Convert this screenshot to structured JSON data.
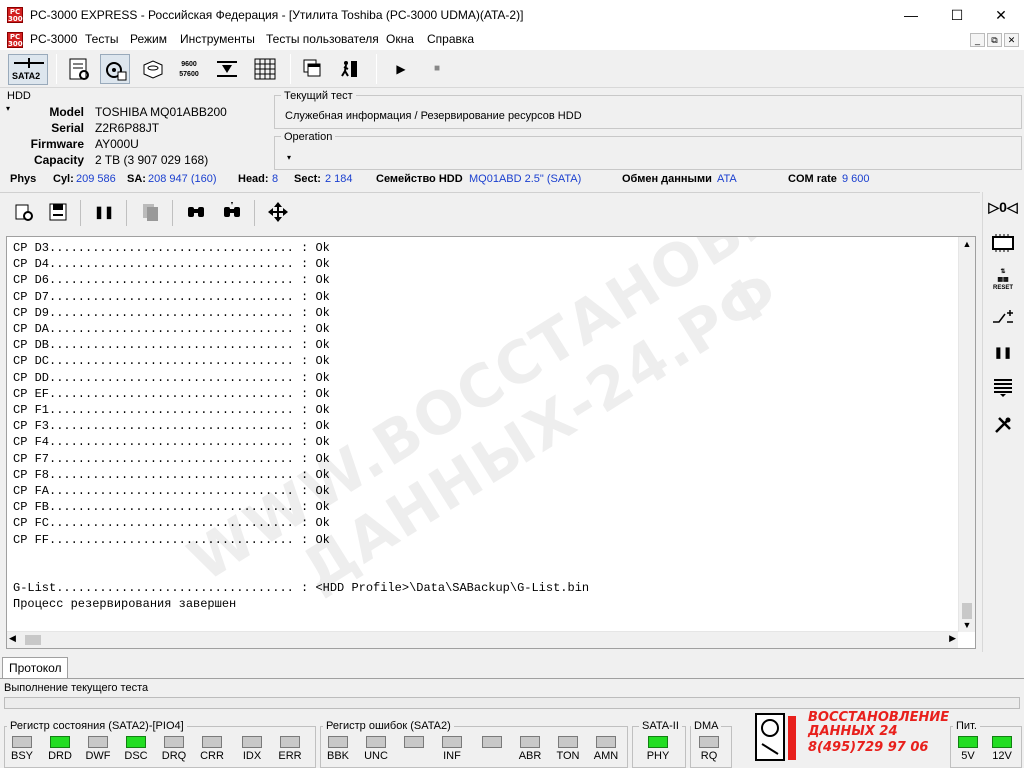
{
  "window": {
    "title": "PC-3000 EXPRESS - Российская Федерация - [Утилита Toshiba (PC-3000 UDMA)(ATA-2)]",
    "icon_text": "PC 3000",
    "minimize": "—",
    "maximize": "☐",
    "close": "✕"
  },
  "menu": {
    "items": [
      "PC-3000",
      "Тесты",
      "Режим",
      "Инструменты",
      "Тесты пользователя",
      "Окна",
      "Справка"
    ],
    "mdi_min": "_",
    "mdi_restore": "⧉",
    "mdi_close": "✕"
  },
  "toolbar": {
    "sata_label": "SATA2",
    "speed_top": "9600",
    "speed_bottom": "57600",
    "icons": [
      "drive-scan-icon",
      "gear-drive-icon",
      "disk-icon",
      "baud-rate-icon",
      "lba-icon",
      "grid-icon",
      "windows-icon",
      "exit-icon",
      "play-icon",
      "stop-icon"
    ]
  },
  "hdd": {
    "group_label": "HDD",
    "fields": [
      {
        "name": "Model",
        "value": "TOSHIBA MQ01ABB200"
      },
      {
        "name": "Serial",
        "value": "Z2R6P88JT"
      },
      {
        "name": "Firmware",
        "value": "AY000U"
      },
      {
        "name": "Capacity",
        "value": "2 TB (3 907 029 168)"
      }
    ]
  },
  "current_test": {
    "label": "Текущий тест",
    "value": "Служебная информация / Резервирование ресурсов HDD"
  },
  "operation": {
    "label": "Operation",
    "value": ""
  },
  "phys": {
    "phys_label": "Phys",
    "cyl_label": "Cyl:",
    "cyl": "209 586",
    "sa_label": "SA:",
    "sa": "208 947 (160)",
    "head_label": "Head:",
    "head": "8",
    "sect_label": "Sect:",
    "sect": "2 184",
    "family_label": "Семейство HDD",
    "family": "MQ01ABD 2.5\" (SATA)",
    "exchange_label": "Обмен данными",
    "exchange": "ATA",
    "com_label": "COM rate",
    "com": "9 600"
  },
  "log": {
    "lines": [
      "CP D3.................................. : Ok",
      "CP D4.................................. : Ok",
      "CP D6.................................. : Ok",
      "CP D7.................................. : Ok",
      "CP D9.................................. : Ok",
      "CP DA.................................. : Ok",
      "CP DB.................................. : Ok",
      "CP DC.................................. : Ok",
      "CP DD.................................. : Ok",
      "CP EF.................................. : Ok",
      "CP F1.................................. : Ok",
      "CP F3.................................. : Ok",
      "CP F4.................................. : Ok",
      "CP F7.................................. : Ok",
      "CP F8.................................. : Ok",
      "CP FA.................................. : Ok",
      "CP FB.................................. : Ok",
      "CP FC.................................. : Ok",
      "CP FF.................................. : Ok",
      "",
      "",
      "G-List................................. : <HDD Profile>\\Data\\SABackup\\G-List.bin",
      "Процесс резервирования завершен"
    ],
    "watermark_line1": "WWW.ВОССТАНОВЛЕНИЕ-",
    "watermark_line2": "ДАННЫХ-24.РФ"
  },
  "tabs": [
    "Протокол"
  ],
  "progress_label": "Выполнение текущего теста",
  "status_register": {
    "title": "Регистр состояния (SATA2)-[PIO4]",
    "leds": [
      {
        "label": "BSY",
        "on": false
      },
      {
        "label": "DRD",
        "on": true
      },
      {
        "label": "DWF",
        "on": false
      },
      {
        "label": "DSC",
        "on": true
      },
      {
        "label": "DRQ",
        "on": false
      },
      {
        "label": "CRR",
        "on": false
      },
      {
        "label": "IDX",
        "on": false
      },
      {
        "label": "ERR",
        "on": false
      }
    ]
  },
  "error_register": {
    "title": "Регистр ошибок  (SATA2)",
    "leds": [
      {
        "label": "BBK",
        "on": false
      },
      {
        "label": "UNC",
        "on": false
      },
      {
        "label": "",
        "on": false
      },
      {
        "label": "INF",
        "on": false
      },
      {
        "label": "",
        "on": false
      },
      {
        "label": "ABR",
        "on": false
      },
      {
        "label": "TON",
        "on": false
      },
      {
        "label": "AMN",
        "on": false
      }
    ]
  },
  "sata": {
    "title": "SATA-II",
    "led_label": "PHY",
    "on": true
  },
  "dma": {
    "title": "DMA",
    "led_label": "RQ",
    "on": false
  },
  "brand": {
    "line1": "ВОССТАНОВЛЕНИЕ",
    "line2": "ДАННЫХ  24",
    "line3": "8(495)729 97 06",
    "color": "#e8201c"
  },
  "power": {
    "title": "Пит.",
    "leds": [
      {
        "label": "5V",
        "on": true
      },
      {
        "label": "12V",
        "on": true
      }
    ]
  }
}
